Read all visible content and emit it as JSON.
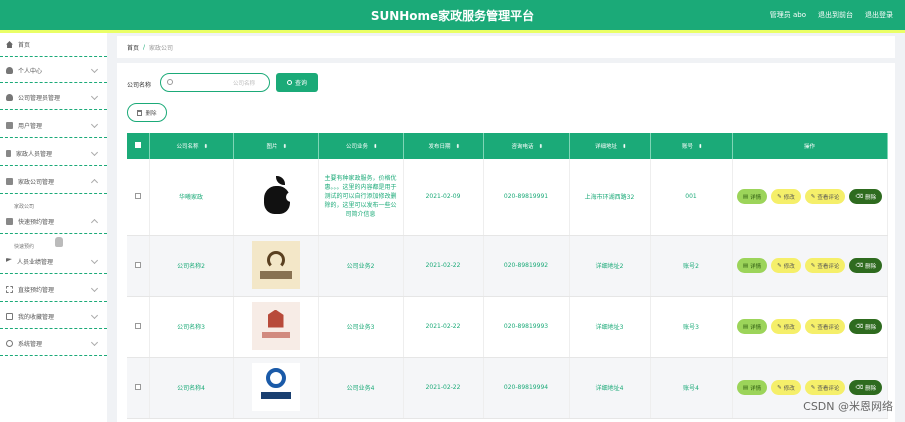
{
  "header": {
    "title": "SUNHome家政服务管理平台",
    "links": [
      "管理员 abo",
      "退出到前台",
      "退出登录"
    ]
  },
  "sidebar": {
    "items": [
      {
        "label": "首页",
        "icon": "home-icon"
      },
      {
        "label": "个人中心",
        "icon": "user-icon"
      },
      {
        "label": "公司管理员管理",
        "icon": "user-icon"
      },
      {
        "label": "用户管理",
        "icon": "monitor-icon"
      },
      {
        "label": "家政人员管理",
        "icon": "phone-icon"
      },
      {
        "label": "家政公司管理",
        "icon": "grid-icon"
      },
      {
        "label": "快速预约管理",
        "icon": "clock-icon"
      },
      {
        "label": "人员业绩管理",
        "icon": "flag-icon"
      },
      {
        "label": "直接预约管理",
        "icon": "frame-icon"
      },
      {
        "label": "我的收藏管理",
        "icon": "bookmark-icon"
      },
      {
        "label": "系统管理",
        "icon": "gear-icon"
      }
    ],
    "ghost_labels": [
      "家政公司",
      "快速预约"
    ]
  },
  "breadcrumb": {
    "home": "首页",
    "separator": "/",
    "current": "家政公司"
  },
  "search": {
    "label": "公司名称",
    "placeholder": "公司名称",
    "button": "查询"
  },
  "toolbar": {
    "delete_label": "删除"
  },
  "table": {
    "columns": [
      "公司名称",
      "图片",
      "公司业务",
      "发布日期",
      "咨询电话",
      "详细地址",
      "账号",
      "操作"
    ],
    "rows": [
      {
        "name": "华曦家政",
        "logo": "apple",
        "business": "主要有种家政服务，价格优惠。。。这里的内容都是用于测试的可以自行添加修改删除的，这里可以发布一些公司简介信息",
        "date": "2021-02-09",
        "phone": "020-89819991",
        "address": "上海市环湖西路32",
        "account": "001"
      },
      {
        "name": "公司名称2",
        "logo": "l2",
        "business": "公司业务2",
        "date": "2021-02-22",
        "phone": "020-89819992",
        "address": "详细地址2",
        "account": "账号2"
      },
      {
        "name": "公司名称3",
        "logo": "l3",
        "business": "公司业务3",
        "date": "2021-02-22",
        "phone": "020-89819993",
        "address": "详细地址3",
        "account": "账号3"
      },
      {
        "name": "公司名称4",
        "logo": "l4",
        "business": "公司业务4",
        "date": "2021-02-22",
        "phone": "020-89819994",
        "address": "详细地址4",
        "account": "账号4"
      }
    ],
    "actions": {
      "detail": "详情",
      "edit": "修改",
      "review": "查看评论",
      "delete": "删除"
    }
  },
  "watermark": "CSDN @米恩网络",
  "colors": {
    "primary": "#1baa78",
    "accent_bar": "#eaff66",
    "detail_btn": "#9cd45a",
    "edit_btn": "#f5ef6a",
    "delete_btn": "#2e6b1f"
  }
}
